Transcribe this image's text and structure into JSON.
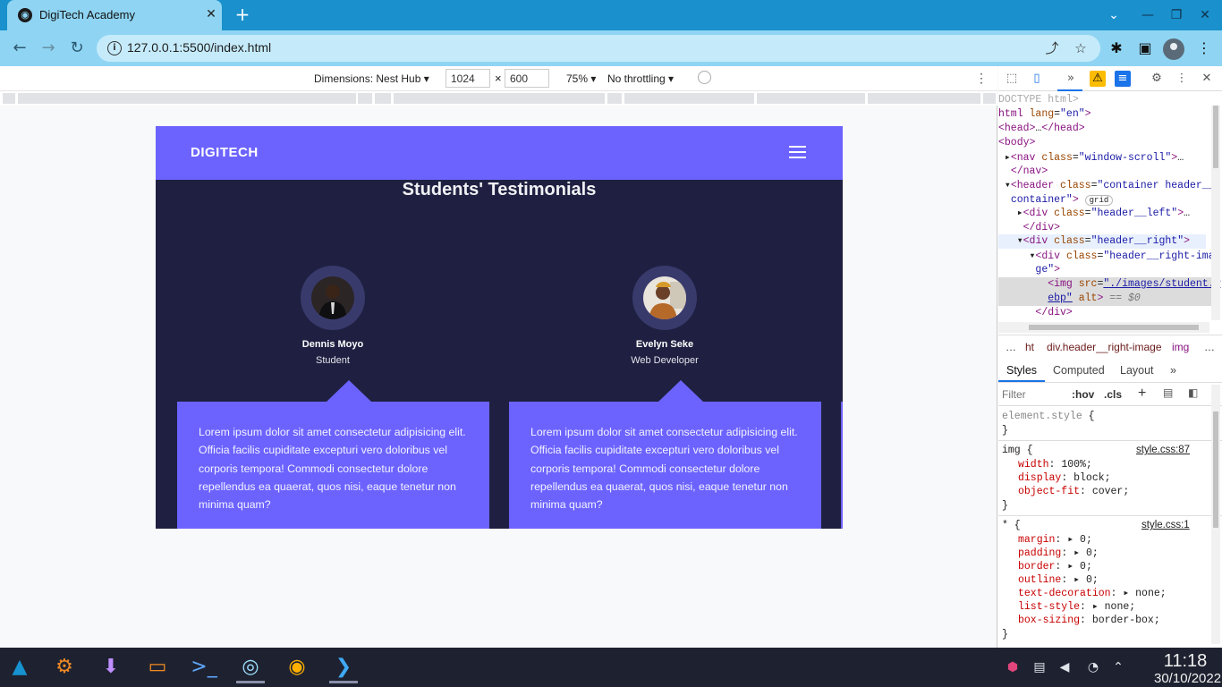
{
  "browser": {
    "tab_title": "DigiTech Academy",
    "tab_close": "✕",
    "new_tab": "+",
    "url": "127.0.0.1:5500/index.html"
  },
  "device_toolbar": {
    "dimensions_label": "Dimensions: Nest Hub ▾",
    "width": "1024",
    "height": "600",
    "times": "×",
    "zoom": "75% ▾",
    "throttling": "No throttling ▾"
  },
  "page": {
    "logo": "DIGITECH",
    "section_title": "Students' Testimonials",
    "testimonials": [
      {
        "name": "Dennis Moyo",
        "role": "Student",
        "text": "Lorem ipsum dolor sit amet consectetur adipisicing elit. Officia facilis cupiditate excepturi vero doloribus vel corporis tempora! Commodi consectetur dolore repellendus ea quaerat, quos nisi, eaque tenetur non minima quam?"
      },
      {
        "name": "Evelyn Seke",
        "role": "Web Developer",
        "text": "Lorem ipsum dolor sit amet consectetur adipisicing elit. Officia facilis cupiditate excepturi vero doloribus vel corporis tempora! Commodi consectetur dolore repellendus ea quaerat, quos nisi, eaque tenetur non minima quam?"
      }
    ]
  },
  "devtools": {
    "breadcrumb": [
      "…",
      "ht",
      "div.header__right-image",
      "img",
      "…"
    ],
    "tabs": [
      "Styles",
      "Computed",
      "Layout",
      "»"
    ],
    "filter_placeholder": "Filter",
    "hov": ":hov",
    "cls": ".cls",
    "plus": "+",
    "rule_img_source": "style.css:87",
    "rule_star_source": "style.css:1"
  },
  "taskbar": {
    "time": "11:18",
    "date": "30/10/2022"
  }
}
